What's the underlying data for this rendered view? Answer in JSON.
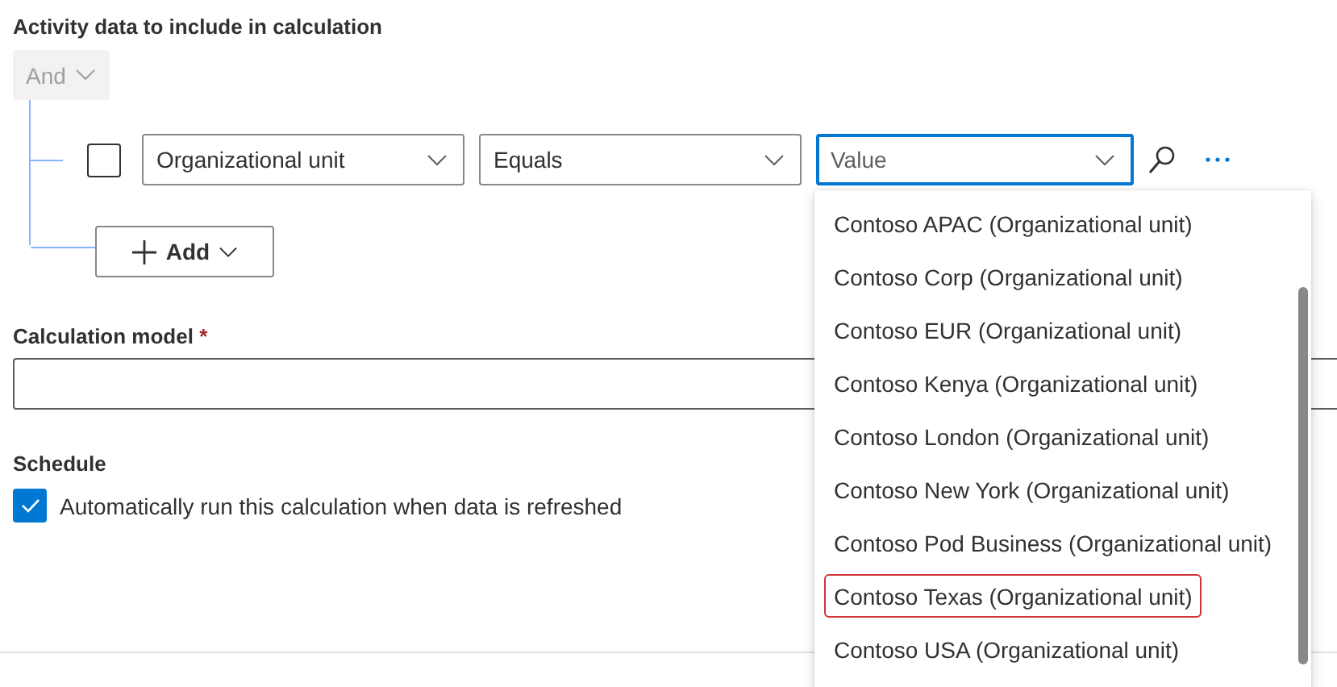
{
  "section_title": "Activity data to include in calculation",
  "group": {
    "operator": "And",
    "disabled": true
  },
  "condition": {
    "checked": false,
    "field": "Organizational unit",
    "operator": "Equals",
    "value_field": {
      "placeholder": "Value",
      "focused": true
    }
  },
  "add_button": {
    "label": "Add"
  },
  "calculation_model": {
    "label": "Calculation model",
    "required_mark": "*"
  },
  "schedule": {
    "label": "Schedule",
    "checkbox": {
      "label": "Automatically run this calculation when data is refreshed",
      "checked": true
    }
  },
  "value_dropdown": {
    "options": [
      {
        "label": "Contoso APAC (Organizational unit)",
        "highlighted": false
      },
      {
        "label": "Contoso Corp (Organizational unit)",
        "highlighted": false
      },
      {
        "label": "Contoso EUR (Organizational unit)",
        "highlighted": false
      },
      {
        "label": "Contoso Kenya (Organizational unit)",
        "highlighted": false
      },
      {
        "label": "Contoso London (Organizational unit)",
        "highlighted": false
      },
      {
        "label": "Contoso New York (Organizational unit)",
        "highlighted": false
      },
      {
        "label": "Contoso Pod Business (Organizational unit)",
        "highlighted": false
      },
      {
        "label": "Contoso Texas (Organizational unit)",
        "highlighted": true
      },
      {
        "label": "Contoso USA (Organizational unit)",
        "highlighted": false
      }
    ]
  }
}
